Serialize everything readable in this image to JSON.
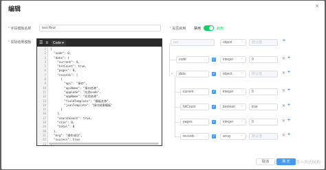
{
  "dialog": {
    "title": "编辑",
    "close": "×"
  },
  "form": {
    "name_label": "字段模板名称",
    "name_value": "test Rest",
    "enabled_label": "是否启用",
    "switch_off": "禁用",
    "switch_on": "启用",
    "example_label": "实际结果模板"
  },
  "editor": {
    "mode": "Code",
    "line_numbers": [
      "1",
      "2",
      "3",
      "4",
      "5",
      "6",
      "7",
      "8",
      "9",
      "10",
      "11",
      "12",
      "13",
      "14",
      "15",
      "16",
      "17",
      "18",
      "19",
      "20",
      "21",
      "22",
      "23"
    ],
    "lines": [
      "{",
      "  \"code\": 0,",
      "  \"data\": {",
      "    \"current\": 0,",
      "    \"hitCount\": true,",
      "    \"pages\": 0,",
      "    \"records\": [",
      "      {",
      "        \"api\": \"接口\",",
      "        \"apiName\": \"接口名称\",",
      "        \"appCode\": \"应用code\",",
      "        \"appName\": \"应用名称\",",
      "        \"fieldTemplate\": \"模板名称\",",
      "        \"jsonTemplate\": \"接口结果模板\"",
      "      }",
      "    ],",
      "    \"searchCount\": true,",
      "    \"size\": 0,",
      "    \"total\": 0",
      "  },",
      "  \"msg\": \"操作成功\",",
      "  \"success\": true",
      "}"
    ]
  },
  "fields": {
    "root_value": "roo",
    "root_type": "object",
    "root_default": "默认值",
    "rows": [
      {
        "name": "code",
        "type": "integer",
        "value": "0"
      },
      {
        "name": "data",
        "type": "object",
        "value": "默认值"
      },
      {
        "name": "current",
        "type": "integer",
        "value": "0"
      },
      {
        "name": "hitCount",
        "type": "boolean",
        "value": "true"
      },
      {
        "name": "pages",
        "type": "integer",
        "value": "0"
      },
      {
        "name": "records",
        "type": "array",
        "value": "默认值"
      }
    ]
  },
  "footer": {
    "cancel": "取消",
    "confirm": "确 定",
    "watermark": "CSDN @我是一只代码狗"
  }
}
